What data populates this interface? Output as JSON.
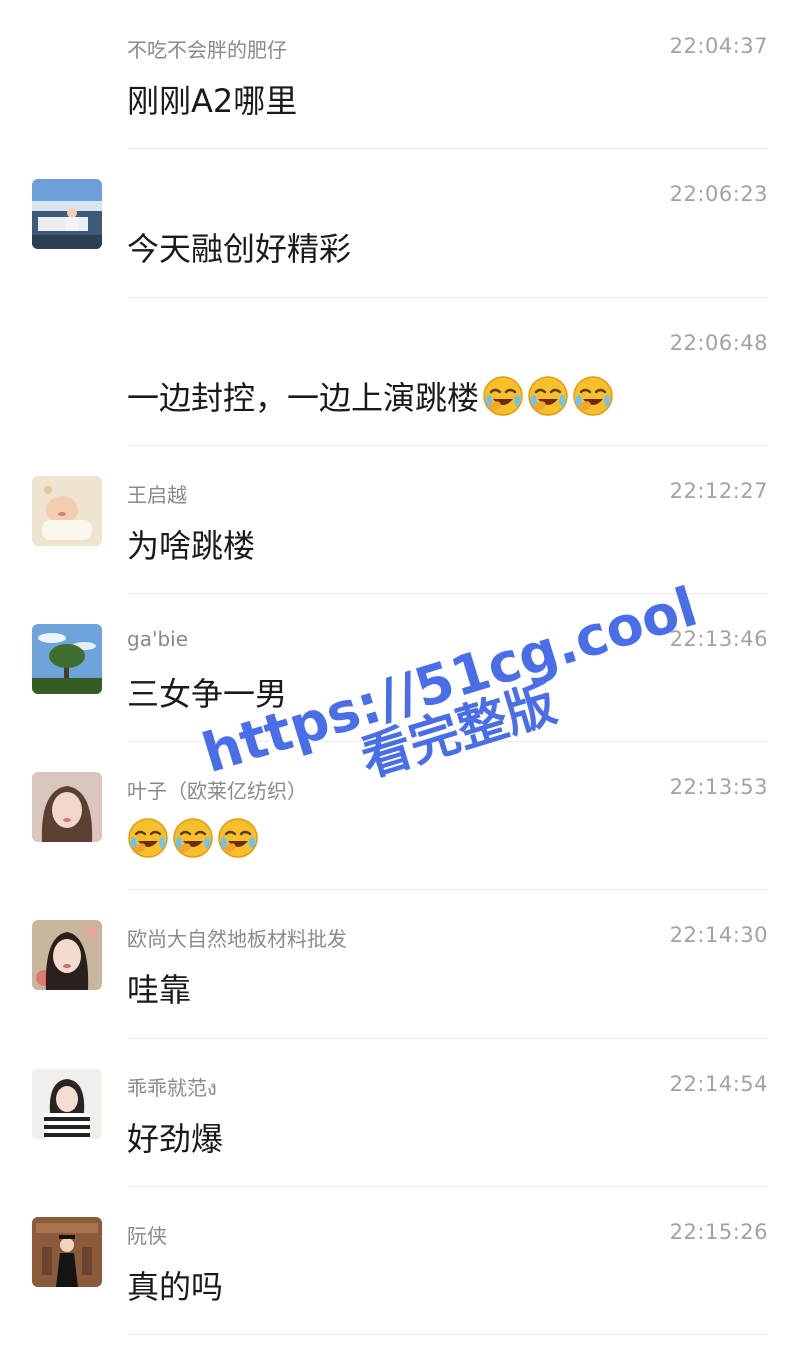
{
  "messages": [
    {
      "sender": "不吃不会胖的肥仔",
      "time": "22:04:37",
      "text": "刚刚A2哪里",
      "emoji_count": 0,
      "avatar": "none"
    },
    {
      "sender": "",
      "time": "22:06:23",
      "text": "今天融创好精彩",
      "emoji_count": 0,
      "avatar": "lakeside-photo-avatar"
    },
    {
      "sender": "",
      "time": "22:06:48",
      "text": "一边封控，一边上演跳楼",
      "emoji_count": 3,
      "avatar": "none"
    },
    {
      "sender": "王启越",
      "time": "22:12:27",
      "text": "为啥跳楼",
      "emoji_count": 0,
      "avatar": "baby-photo-avatar"
    },
    {
      "sender": "ga'bie",
      "time": "22:13:46",
      "text": "三女争一男",
      "emoji_count": 0,
      "avatar": "tree-sky-avatar"
    },
    {
      "sender": "叶子（欧莱亿纺织）",
      "time": "22:13:53",
      "text": "",
      "emoji_count": 3,
      "avatar": "woman-portrait-avatar"
    },
    {
      "sender": "欧尚大自然地板材料批发",
      "time": "22:14:30",
      "text": "哇靠",
      "emoji_count": 0,
      "avatar": "woman-flowers-avatar"
    },
    {
      "sender": "乖乖就范ง",
      "time": "22:14:54",
      "text": "好劲爆",
      "emoji_count": 0,
      "avatar": "woman-striped-avatar"
    },
    {
      "sender": "阮侠",
      "time": "22:15:26",
      "text": "真的吗",
      "emoji_count": 0,
      "avatar": "graduate-photo-avatar"
    }
  ],
  "emoji_name": "face-with-tears-of-joy-emoji",
  "watermark": {
    "line1": "https://51cg.cool",
    "line2": "看完整版",
    "color": "#4a6ee8"
  },
  "colors": {
    "sender": "#8a8a8a",
    "time": "#a3a3a3",
    "text": "#1a1a1a",
    "divider": "#ececec"
  }
}
